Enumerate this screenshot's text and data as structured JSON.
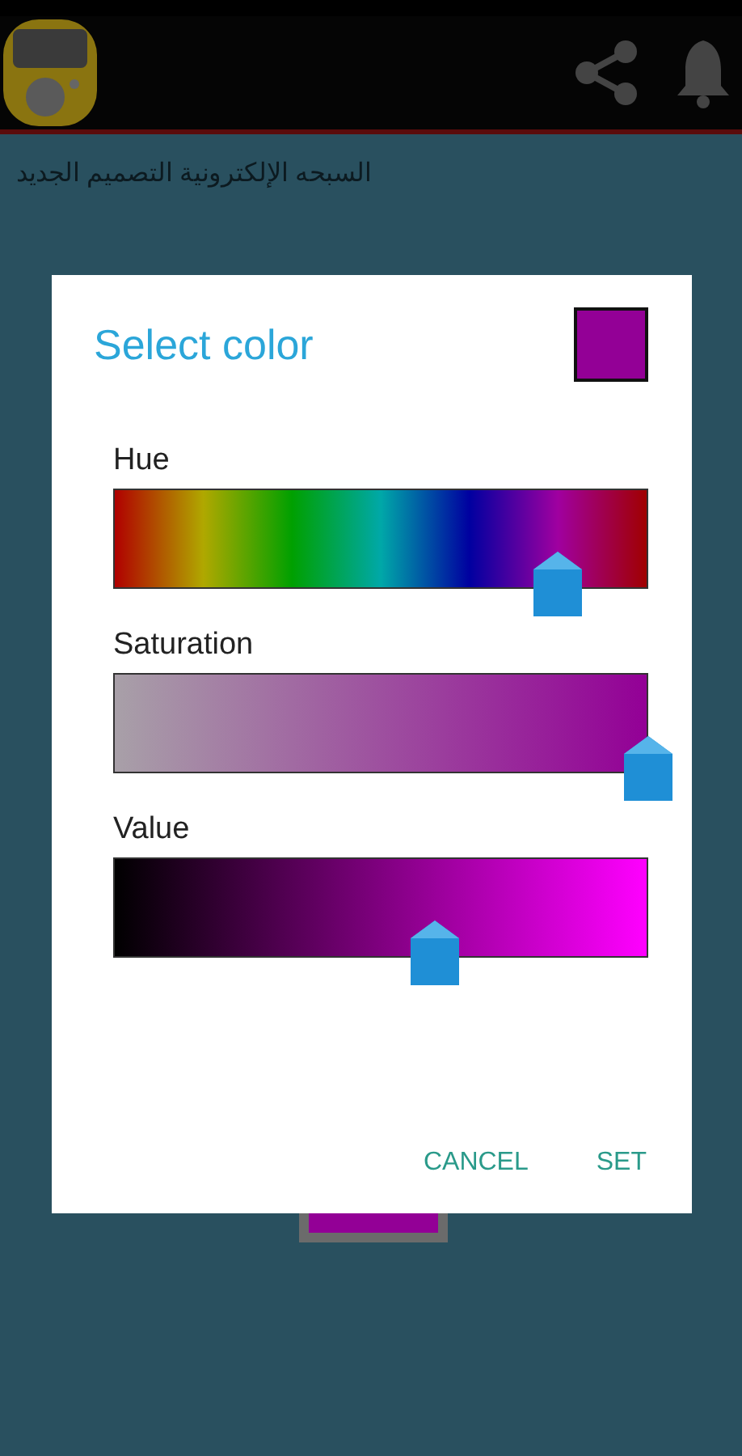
{
  "app_bar": {
    "actions": [
      {
        "kind": "share"
      },
      {
        "kind": "bell"
      }
    ]
  },
  "subtitle": "السبحه الإلكترونية التصميم الجديد",
  "dialog": {
    "title": "Select color",
    "sliders": [
      {
        "kind": "hue",
        "label": "Hue",
        "level": 0.83
      },
      {
        "kind": "saturation",
        "label": "Saturation",
        "level": 1.0
      },
      {
        "kind": "value",
        "label": "Value",
        "level": 0.6
      }
    ],
    "buttons": [
      "CANCEL",
      "SET"
    ]
  }
}
